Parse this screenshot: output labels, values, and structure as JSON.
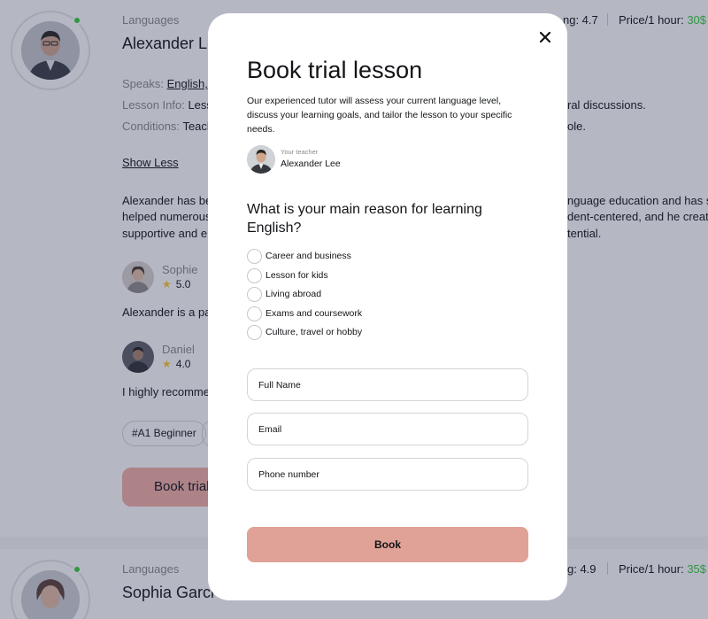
{
  "background": {
    "tutor1": {
      "category": "Languages",
      "name": "Alexander Le",
      "rating_fragment": "ng: 4.7",
      "price_label": "Price/1 hour:",
      "price_value": "30$",
      "speaks_label": "Speaks:",
      "speaks_value": "English, K",
      "lesson_info_label": "Lesson Info:",
      "lesson_info_value": "Lesso",
      "lesson_info_right": "ral discussions.",
      "conditions_label": "Conditions:",
      "conditions_value": "Teach",
      "conditions_right": "ole.",
      "show_less": "Show Less",
      "bio": [
        "Alexander has bee",
        "helped numerous s",
        "supportive and en"
      ],
      "bio_right": [
        "nguage education and has suc",
        "dent-centered, and he creates",
        "tential."
      ],
      "reviews": [
        {
          "name": "Sophie",
          "rating": "5.0",
          "text": "Alexander is a pati"
        },
        {
          "name": "Daniel",
          "rating": "4.0",
          "text": "I highly recommen"
        }
      ],
      "tags": [
        "#A1 Beginner"
      ],
      "book_button": "Book trial"
    },
    "tutor2": {
      "category": "Languages",
      "name": "Sophia Garci",
      "rating_fragment": "g: 4.9",
      "price_label": "Price/1 hour:",
      "price_value": "35$"
    }
  },
  "modal": {
    "title": "Book trial lesson",
    "description": "Our experienced tutor will assess your current language level, discuss your learning goals, and tailor the lesson to your specific needs.",
    "teacher_caption": "Your teacher",
    "teacher_name": "Alexander Lee",
    "question": "What is your main reason for learning English?",
    "options": [
      "Career and business",
      "Lesson for kids",
      "Living abroad",
      "Exams and coursework",
      "Culture, travel or hobby"
    ],
    "fields": {
      "full_name_placeholder": "Full Name",
      "email_placeholder": "Email",
      "phone_placeholder": "Phone number"
    },
    "submit_label": "Book",
    "close_icon": "close-icon"
  },
  "colors": {
    "accent": "#f3b0a6",
    "accent_muted": "#e0a197",
    "online": "#38cd3e",
    "star": "#ffc531",
    "overlay": "rgba(38,43,79,0.34)"
  }
}
